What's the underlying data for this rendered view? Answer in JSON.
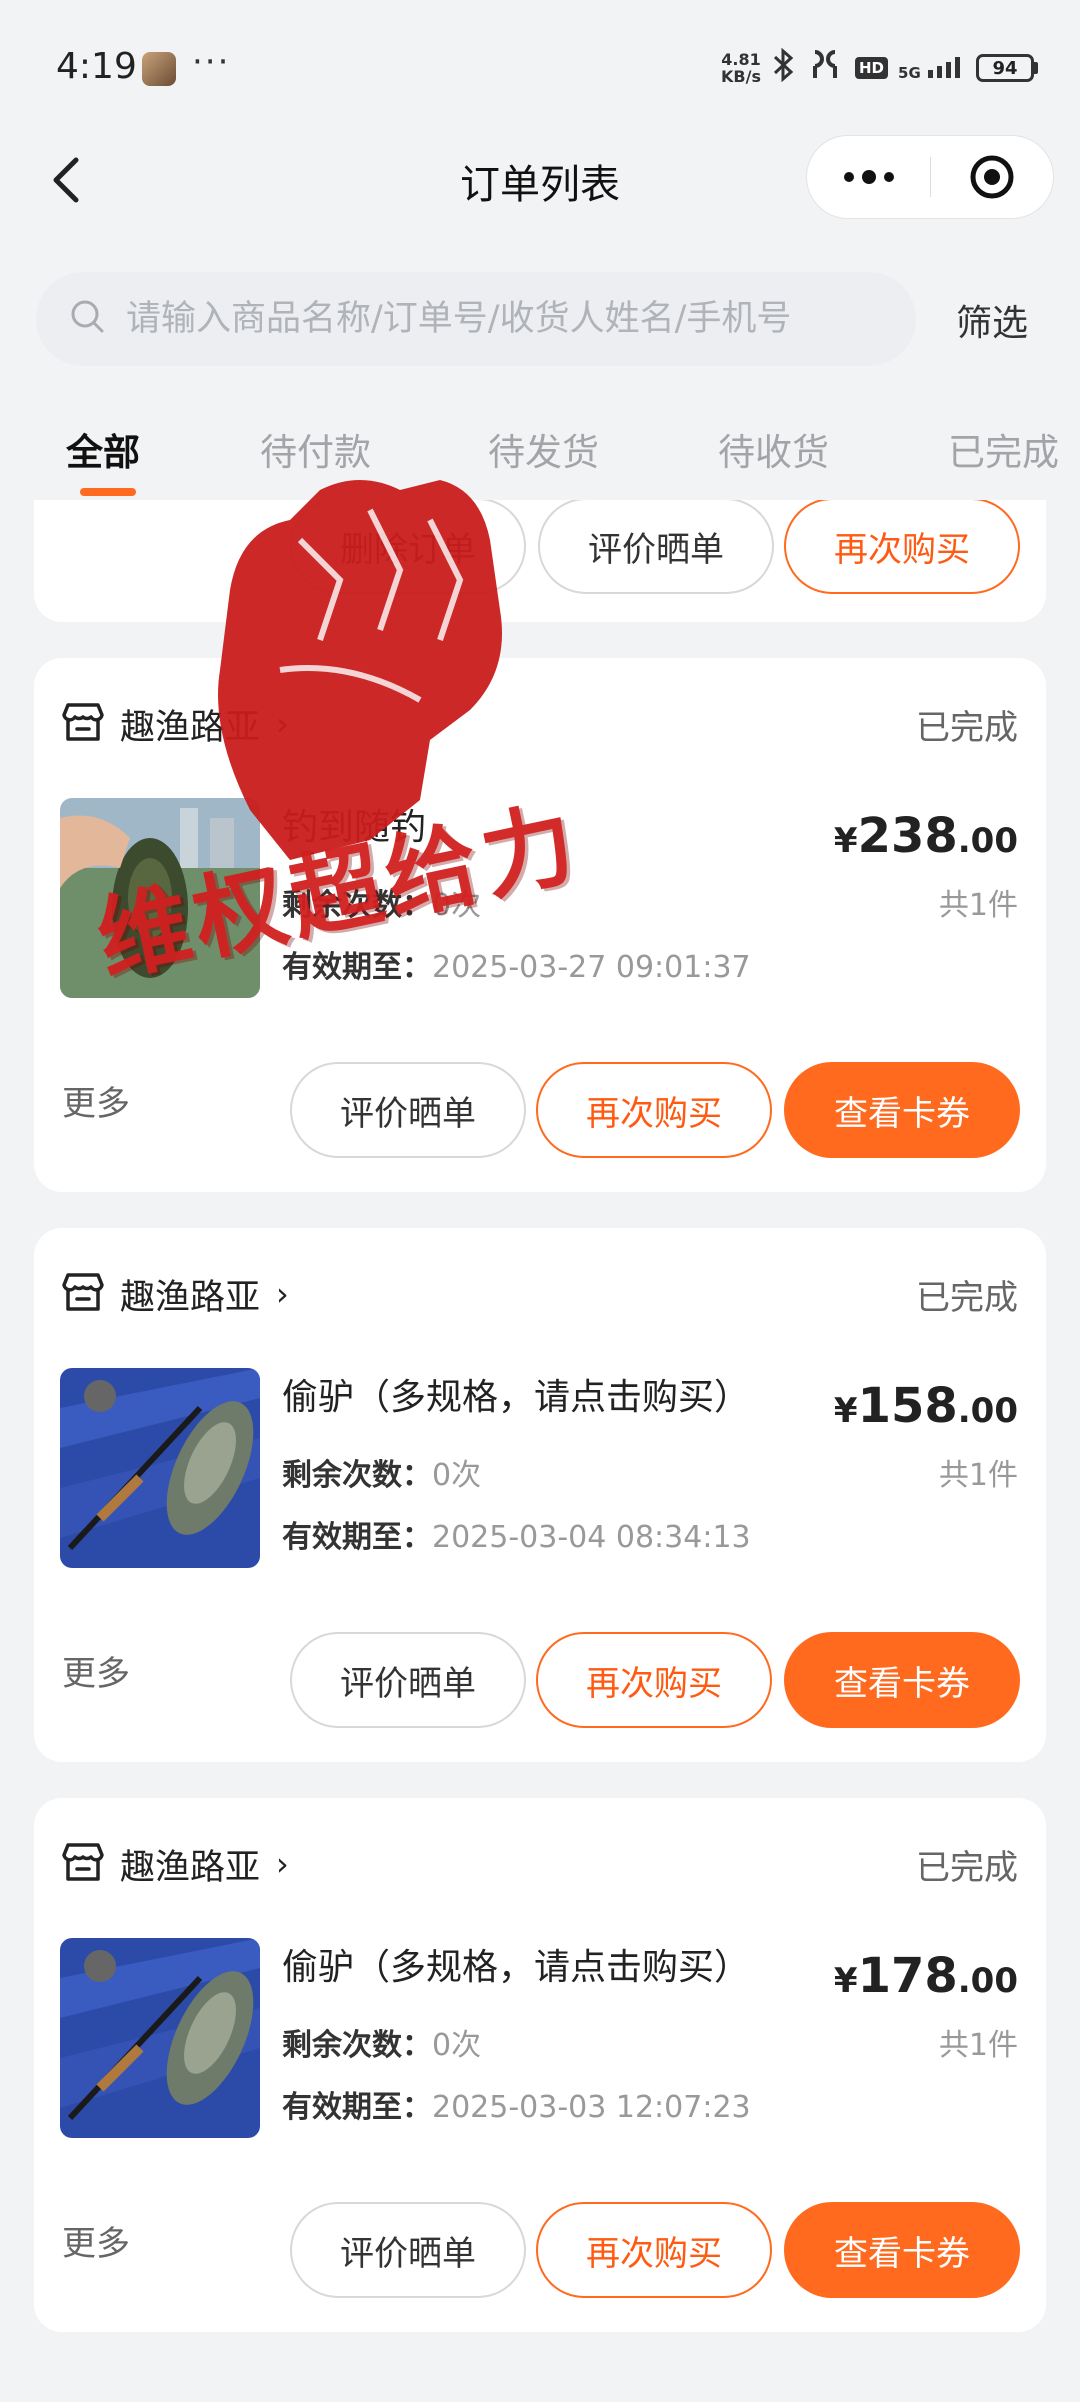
{
  "status_bar": {
    "time": "4:19",
    "dots": "···",
    "net_speed_value": "4.81",
    "net_speed_unit": "KB/s",
    "hd": "HD",
    "signal": "5G",
    "battery": "94"
  },
  "nav": {
    "title": "订单列表",
    "more_icon": "more-dots-icon",
    "close_icon": "target-circle-icon"
  },
  "search": {
    "placeholder": "请输入商品名称/订单号/收货人姓名/手机号",
    "filter_label": "筛选"
  },
  "tabs": [
    {
      "label": "全部",
      "active": true
    },
    {
      "label": "待付款",
      "active": false
    },
    {
      "label": "待发货",
      "active": false
    },
    {
      "label": "待收货",
      "active": false
    },
    {
      "label": "已完成",
      "active": false
    }
  ],
  "partial_card": {
    "buttons": [
      "删除订单",
      "评价晒单",
      "再次购买"
    ]
  },
  "orders": [
    {
      "store": "趣渔路亚",
      "status": "已完成",
      "product": "钓到随钓",
      "remaining_key": "剩余次数：",
      "remaining_val": "0次",
      "expiry_key": "有效期至：",
      "expiry_val": "2025-03-27 09:01:37",
      "price_currency": "¥",
      "price_int": "238",
      "price_dec": ".00",
      "quantity": "共1件",
      "more": "更多",
      "btn_review": "评价晒单",
      "btn_rebuy": "再次购买",
      "btn_coupon": "查看卡券"
    },
    {
      "store": "趣渔路亚",
      "status": "已完成",
      "product": "偷驴（多规格，请点击购买）",
      "remaining_key": "剩余次数：",
      "remaining_val": "0次",
      "expiry_key": "有效期至：",
      "expiry_val": "2025-03-04 08:34:13",
      "price_currency": "¥",
      "price_int": "158",
      "price_dec": ".00",
      "quantity": "共1件",
      "more": "更多",
      "btn_review": "评价晒单",
      "btn_rebuy": "再次购买",
      "btn_coupon": "查看卡券"
    },
    {
      "store": "趣渔路亚",
      "status": "已完成",
      "product": "偷驴（多规格，请点击购买）",
      "remaining_key": "剩余次数：",
      "remaining_val": "0次",
      "expiry_key": "有效期至：",
      "expiry_val": "2025-03-03 12:07:23",
      "price_currency": "¥",
      "price_int": "178",
      "price_dec": ".00",
      "quantity": "共1件",
      "more": "更多",
      "btn_review": "评价晒单",
      "btn_rebuy": "再次购买",
      "btn_coupon": "查看卡券"
    }
  ],
  "overlay": {
    "text": "维权超给力",
    "color": "#d11f1f"
  },
  "colors": {
    "accent": "#ff6a1f",
    "background": "#f2f3f5"
  }
}
